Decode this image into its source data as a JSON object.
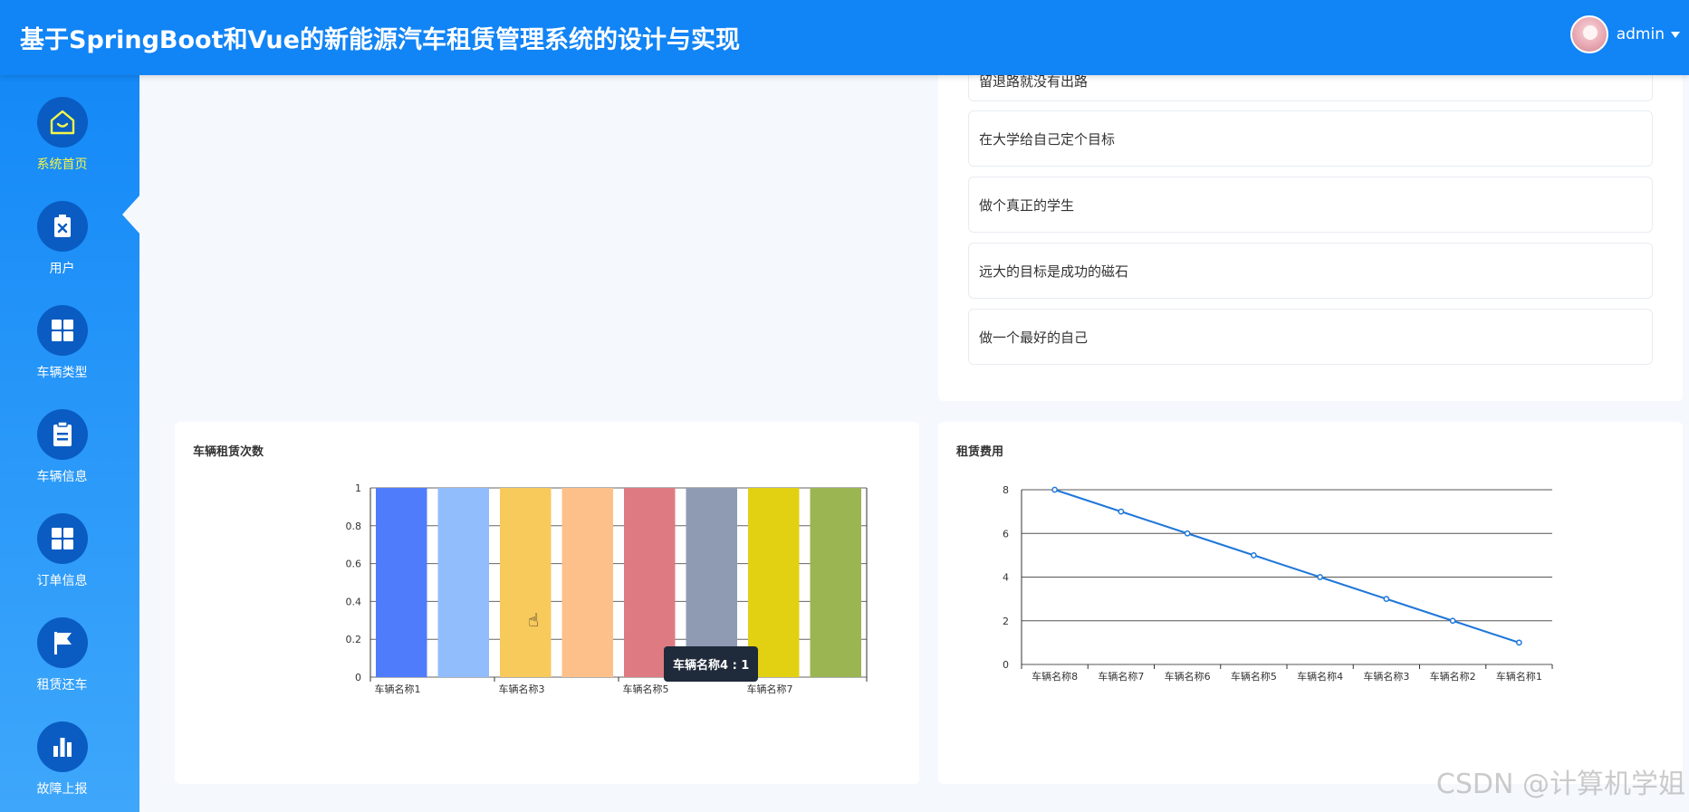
{
  "header": {
    "title": "基于SpringBoot和Vue的新能源汽车租赁管理系统的设计与实现",
    "username": "admin"
  },
  "sidebar": {
    "items": [
      {
        "label": "系统首页",
        "icon": "home-icon",
        "active": true
      },
      {
        "label": "用户",
        "icon": "clipboard-x-icon",
        "active": false
      },
      {
        "label": "车辆类型",
        "icon": "grid-icon",
        "active": false
      },
      {
        "label": "车辆信息",
        "icon": "document-icon",
        "active": false
      },
      {
        "label": "订单信息",
        "icon": "grid-icon",
        "active": false
      },
      {
        "label": "租赁还车",
        "icon": "flag-icon",
        "active": false
      },
      {
        "label": "故障上报",
        "icon": "bar-chart-icon",
        "active": false
      }
    ]
  },
  "news": {
    "items": [
      "留退路就没有出路",
      "在大学给自己定个目标",
      "做个真正的学生",
      "远大的目标是成功的磁石",
      "做一个最好的自己"
    ]
  },
  "colors": {
    "header": "#1184f6",
    "active_nav": "#f5f54a",
    "line": "#1f77d9"
  },
  "chart_data": [
    {
      "type": "bar",
      "title": "车辆租赁次数",
      "categories": [
        "车辆名称1",
        "车辆名称2",
        "车辆名称3",
        "车辆名称4",
        "车辆名称5",
        "车辆名称6",
        "车辆名称7",
        "车辆名称8"
      ],
      "values": [
        1,
        1,
        1,
        1,
        1,
        1,
        1,
        1
      ],
      "visible_tick_labels": [
        "车辆名称1",
        "车辆名称3",
        "车辆名称5",
        "车辆名称7"
      ],
      "bar_colors": [
        "#4f7cfb",
        "#91bdfd",
        "#f8c95b",
        "#fdc08a",
        "#de7b82",
        "#8f9ab3",
        "#e2d012",
        "#9bb552"
      ],
      "ylim": [
        0,
        1
      ],
      "yticks": [
        "0",
        "0.2",
        "0.4",
        "0.6",
        "0.8",
        "1"
      ],
      "grid": true,
      "tooltip": "车辆名称4 : 1"
    },
    {
      "type": "line",
      "title": "租赁费用",
      "categories": [
        "车辆名称8",
        "车辆名称7",
        "车辆名称6",
        "车辆名称5",
        "车辆名称4",
        "车辆名称3",
        "车辆名称2",
        "车辆名称1"
      ],
      "values": [
        8,
        7,
        6,
        5,
        4,
        3,
        2,
        1
      ],
      "ylim": [
        0,
        8
      ],
      "yticks": [
        "0",
        "2",
        "4",
        "6",
        "8"
      ],
      "grid": true
    }
  ],
  "watermark": "CSDN @计算机学姐"
}
